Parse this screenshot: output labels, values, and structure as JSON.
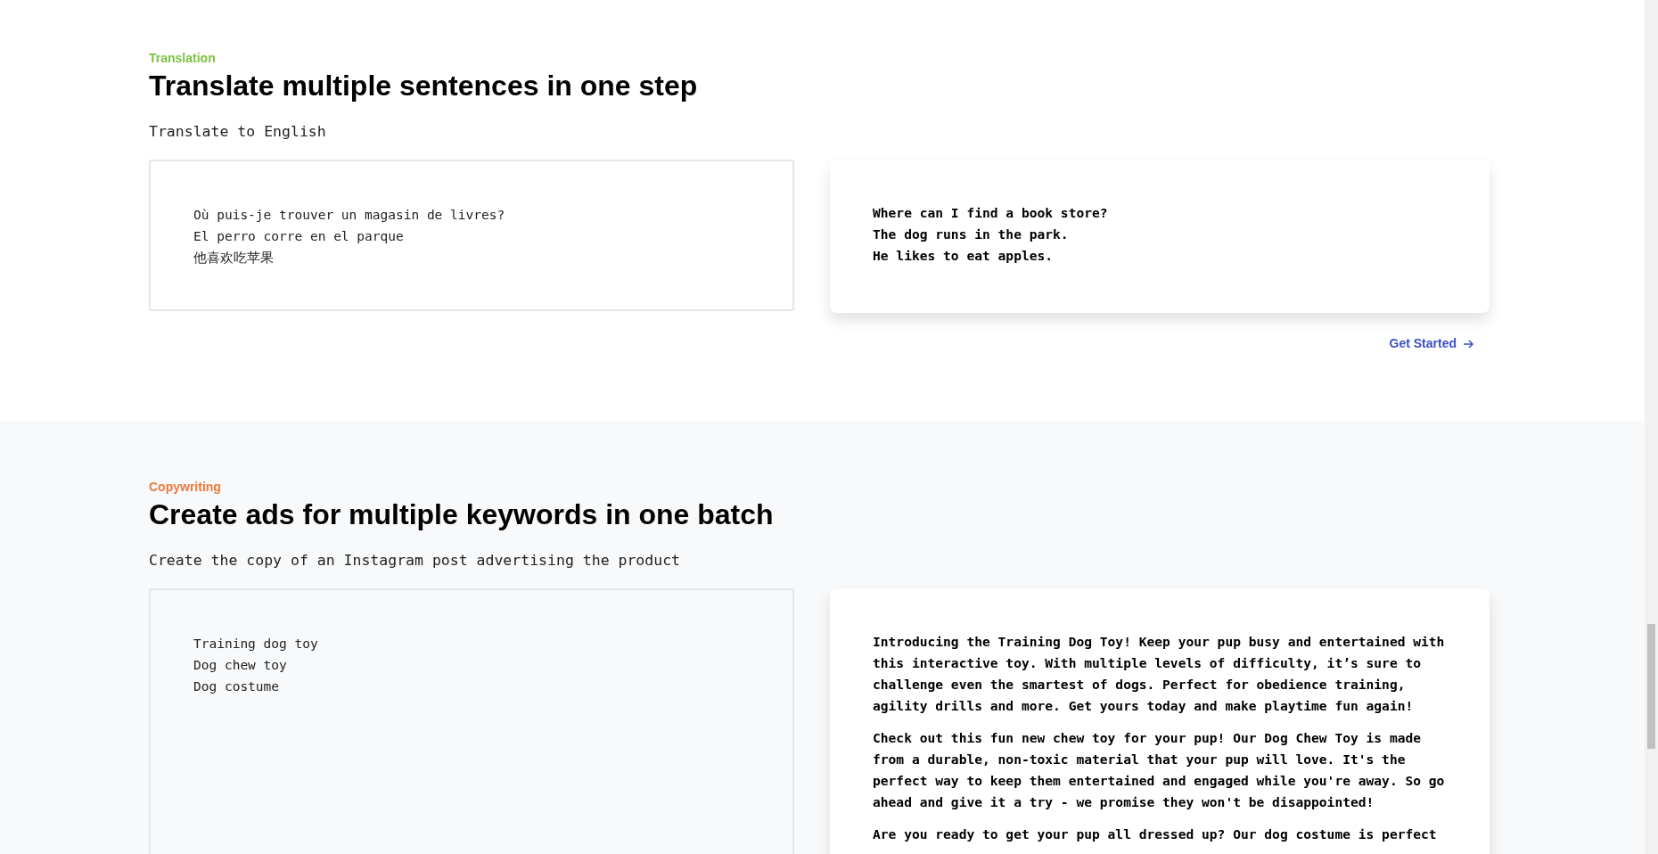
{
  "sections": [
    {
      "kind": "translation",
      "eyebrow": "Translation",
      "color": "#7cc242",
      "title": "Translate multiple sentences in one step",
      "instruction": "Translate to English",
      "input_lines": [
        "Où puis-je trouver un magasin de livres?",
        "El perro corre en el parque",
        "他喜欢吃苹果"
      ],
      "output_paragraphs": [
        "Where can I find a book store?\nThe dog runs in the park.\nHe likes to eat apples."
      ],
      "link": "Get Started"
    },
    {
      "kind": "copywriting",
      "eyebrow": "Copywriting",
      "color": "#ec7a3c",
      "title": "Create ads for multiple keywords in one batch",
      "instruction": "Create the copy of an Instagram post advertising the product",
      "input_lines": [
        "Training dog toy",
        "Dog chew toy",
        "Dog costume"
      ],
      "output_paragraphs": [
        "Introducing the Training Dog Toy! Keep your pup busy and entertained with this interactive toy. With multiple levels of difficulty, it’s sure to challenge even the smartest of dogs. Perfect for obedience training, agility drills and more. Get yours today and make playtime fun again!",
        "Check out this fun new chew toy for your pup! Our Dog Chew Toy is made from a durable, non-toxic material that your pup will love. It's the perfect way to keep them entertained and engaged while you're away. So go ahead and give it a try - we promise they won't be disappointed!",
        "Are you ready to get your pup all dressed up? Our dog costume is perfect"
      ]
    }
  ]
}
